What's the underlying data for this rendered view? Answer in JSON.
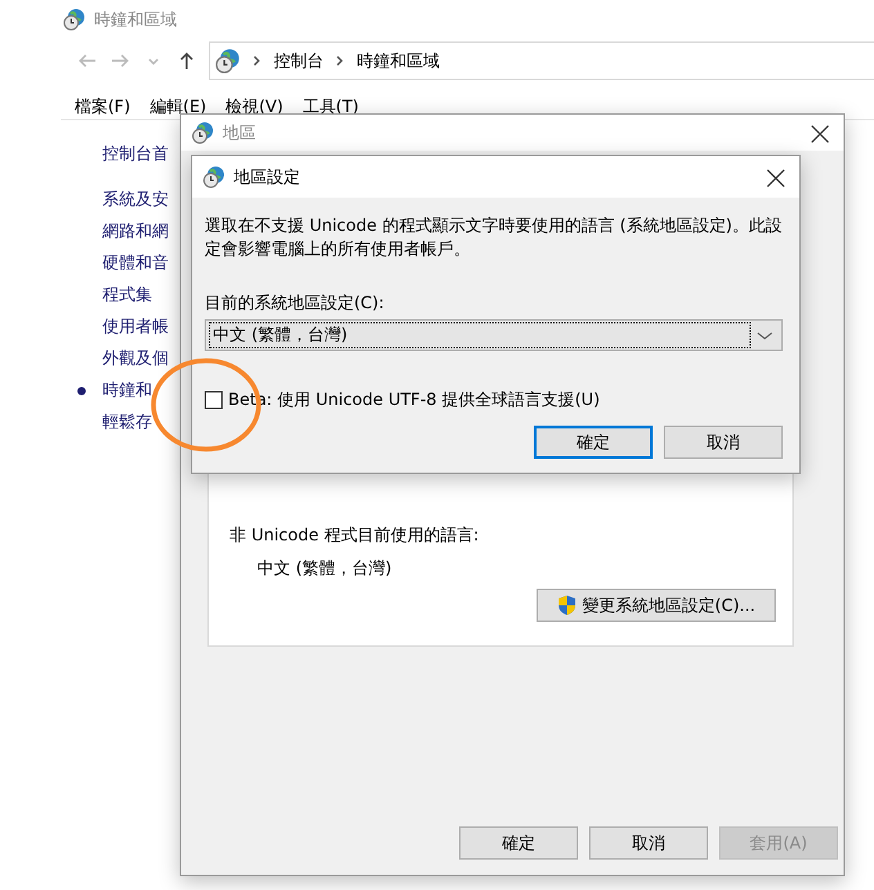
{
  "main_window": {
    "title": "時鐘和區域",
    "breadcrumb": [
      "控制台",
      "時鐘和區域"
    ],
    "menu": [
      "檔案(F)",
      "編輯(E)",
      "檢視(V)",
      "工具(T)"
    ],
    "home_link": "控制台首",
    "sidebar": {
      "items": [
        {
          "label": "系統及安",
          "selected": false
        },
        {
          "label": "網路和網",
          "selected": false
        },
        {
          "label": "硬體和音",
          "selected": false
        },
        {
          "label": "程式集",
          "selected": false
        },
        {
          "label": "使用者帳",
          "selected": false
        },
        {
          "label": "外觀及個",
          "selected": false
        },
        {
          "label": "時鐘和",
          "selected": true
        },
        {
          "label": "輕鬆存",
          "selected": false
        }
      ]
    }
  },
  "region_window": {
    "title": "地區",
    "label": "非 Unicode 程式目前使用的語言:",
    "value": "中文 (繁體，台灣)",
    "change_button": "變更系統地區設定(C)...",
    "buttons": [
      {
        "label": "確定",
        "disabled": false
      },
      {
        "label": "取消",
        "disabled": false
      },
      {
        "label": "套用(A)",
        "disabled": true
      }
    ]
  },
  "locale_dialog": {
    "title": "地區設定",
    "description": "選取在不支援 Unicode 的程式顯示文字時要使用的語言 (系統地區設定)。此設定會影響電腦上的所有使用者帳戶。",
    "select_label": "目前的系統地區設定(C):",
    "select_value": "中文 (繁體，台灣)",
    "beta_checkbox": {
      "label": "Beta: 使用 Unicode UTF-8 提供全球語言支援(U)",
      "checked": false
    },
    "buttons": [
      {
        "label": "確定",
        "default": true
      },
      {
        "label": "取消",
        "default": false
      }
    ]
  }
}
